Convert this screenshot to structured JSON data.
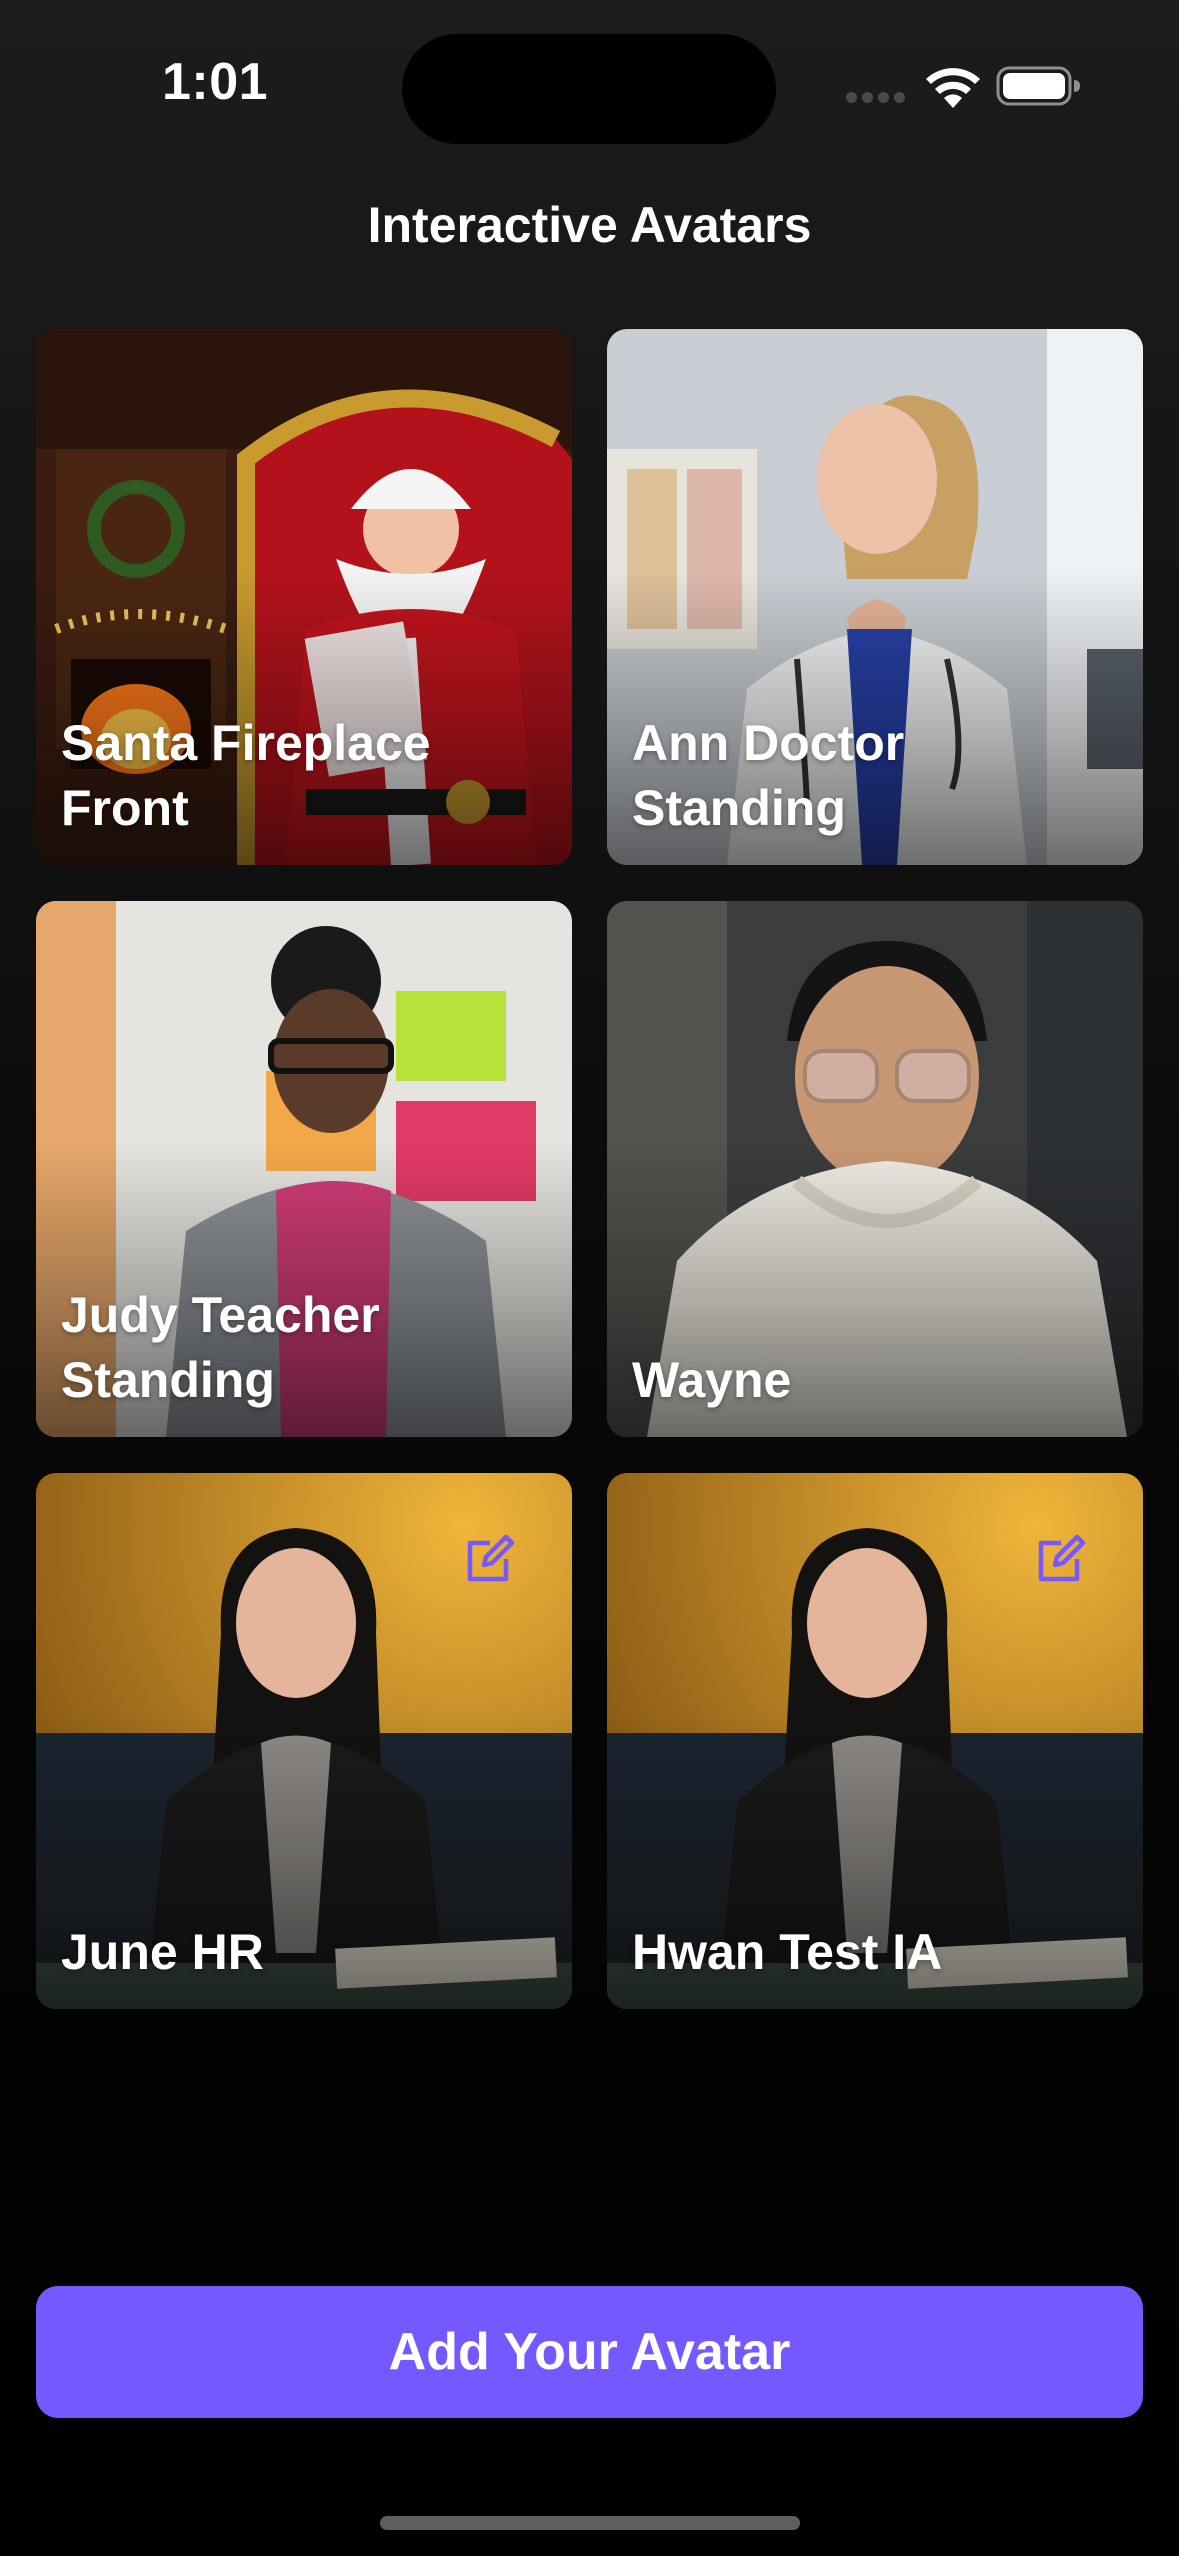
{
  "status_bar": {
    "time": "1:01"
  },
  "header": {
    "title": "Interactive Avatars"
  },
  "avatars": [
    {
      "name": "Santa Fireplace Front",
      "editable": false
    },
    {
      "name": "Ann Doctor Standing",
      "editable": false
    },
    {
      "name": "Judy Teacher Standing",
      "editable": false
    },
    {
      "name": "Wayne",
      "editable": false
    },
    {
      "name": "June HR",
      "editable": true
    },
    {
      "name": "Hwan Test IA",
      "editable": true
    }
  ],
  "cta": {
    "label": "Add Your Avatar"
  },
  "colors": {
    "accent": "#7559ff",
    "edit_icon": "#7559ff",
    "background": "#000000"
  }
}
